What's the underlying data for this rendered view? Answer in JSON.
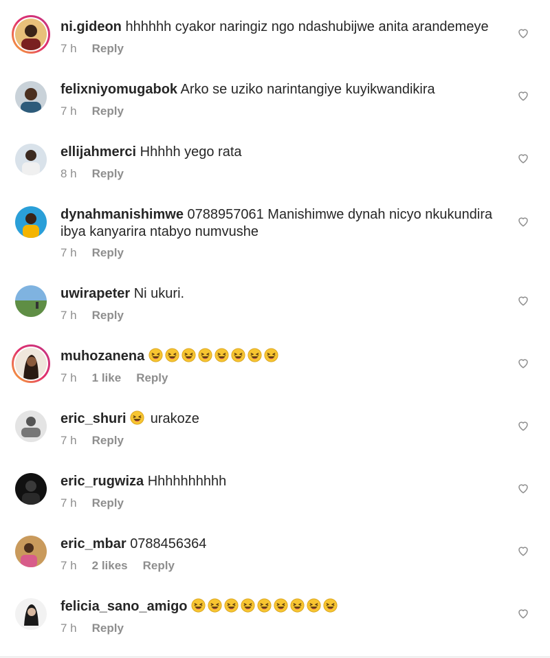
{
  "comments": [
    {
      "username": "ni.gideon",
      "text": "hhhhhh cyakor naringiz ngo ndashubijwe anita arandemeye",
      "time": "7 h",
      "likes": "",
      "reply": "Reply",
      "story_ring": true,
      "avatar_color": "#5a3b2a"
    },
    {
      "username": "felixniyomugabok",
      "text": "Arko se uziko narintangiye kuyikwandikira",
      "time": "7 h",
      "likes": "",
      "reply": "Reply",
      "story_ring": false,
      "avatar_color": "#6b7f8e"
    },
    {
      "username": "ellijahmerci",
      "text": "Hhhhh yego rata",
      "time": "8 h",
      "likes": "",
      "reply": "Reply",
      "story_ring": false,
      "avatar_color": "#8fa3b5"
    },
    {
      "username": "dynahmanishimwe",
      "text": "0788957061 Manishimwe dynah nicyo nkukundira ibya kanyarira ntabyo numvushe",
      "time": "7 h",
      "likes": "",
      "reply": "Reply",
      "story_ring": false,
      "avatar_color": "#2a9fd8"
    },
    {
      "username": "uwirapeter",
      "text": "Ni ukuri.",
      "time": "7 h",
      "likes": "",
      "reply": "Reply",
      "story_ring": false,
      "avatar_color": "#6f9a5c"
    },
    {
      "username": "muhozanena",
      "text": "",
      "emoji_count": 8,
      "time": "7 h",
      "likes": "1 like",
      "reply": "Reply",
      "story_ring": true,
      "avatar_color": "#c9a48a"
    },
    {
      "username": "eric_shuri",
      "text": "urakoze",
      "leading_emoji": 1,
      "time": "7 h",
      "likes": "",
      "reply": "Reply",
      "story_ring": false,
      "avatar_color": "#b0b0b0"
    },
    {
      "username": "eric_rugwiza",
      "text": "Hhhhhhhhhh",
      "time": "7 h",
      "likes": "",
      "reply": "Reply",
      "story_ring": false,
      "avatar_color": "#1d1d1d"
    },
    {
      "username": "eric_mbar",
      "text": "0788456364",
      "time": "7 h",
      "likes": "2 likes",
      "reply": "Reply",
      "story_ring": false,
      "avatar_color": "#a57a4c"
    },
    {
      "username": "felicia_sano_amigo",
      "text": "",
      "emoji_count": 9,
      "time": "7 h",
      "likes": "",
      "reply": "Reply",
      "story_ring": false,
      "avatar_color": "#d8d8d8"
    }
  ],
  "colors": {
    "text": "#262626",
    "meta": "#8e8e8e",
    "emoji": "#f7c531"
  },
  "icons": {
    "like": "heart-outline-icon",
    "emoji": "laughing-emoji-icon"
  }
}
